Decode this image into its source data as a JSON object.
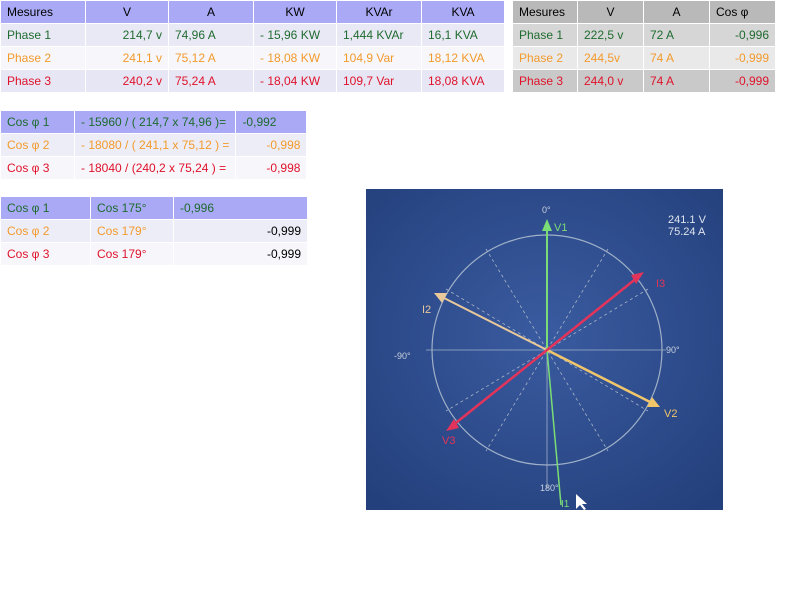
{
  "table1": {
    "headers": [
      "Mesures",
      "V",
      "A",
      "KW",
      "KVAr",
      "KVA"
    ],
    "rows": [
      {
        "phase": "Phase 1",
        "v": "214,7 v",
        "a": "74,96 A",
        "kw": "- 15,96 KW",
        "kvar": "1,444 KVAr",
        "kva": "16,1 KVA"
      },
      {
        "phase": "Phase 2",
        "v": "241,1 v",
        "a": "75,12 A",
        "kw": "- 18,08 KW",
        "kvar": "104,9 Var",
        "kva": "18,12 KVA"
      },
      {
        "phase": "Phase 3",
        "v": "240,2 v",
        "a": "75,24 A",
        "kw": "- 18,04 KW",
        "kvar": "109,7 Var",
        "kva": "18,08  KVA"
      }
    ]
  },
  "table2": {
    "headers": [
      "Mesures",
      "V",
      "A",
      "Cos φ"
    ],
    "rows": [
      {
        "phase": "Phase 1",
        "v": "222,5 v",
        "a": "72 A",
        "cos": "-0,996"
      },
      {
        "phase": "Phase 2",
        "v": "244,5v",
        "a": "74 A",
        "cos": "-0,999"
      },
      {
        "phase": "Phase 3",
        "v": "244,0 v",
        "a": "74 A",
        "cos": "-0,999"
      }
    ]
  },
  "cos_calc": [
    {
      "label": "Cos φ 1",
      "formula": "- 15960 / ( 214,7 x 74,96 )=",
      "value": "-0,992"
    },
    {
      "label": "Cos φ 2",
      "formula": "- 18080 / ( 241,1 x 75,12 ) =",
      "value": "-0,998"
    },
    {
      "label": "Cos φ 3",
      "formula": "- 18040 / (240,2 x 75,24 ) =",
      "value": "-0,998"
    }
  ],
  "cos_angle": [
    {
      "label": "Cos φ 1",
      "angle": "Cos 175°",
      "value": "-0,996"
    },
    {
      "label": "Cos φ 2",
      "angle": "Cos 179°",
      "value": "-0,999"
    },
    {
      "label": "Cos φ 3",
      "angle": "Cos 179°",
      "value": "-0,999"
    }
  ],
  "photo": {
    "readout_v": "241.1 V",
    "readout_a": "75.24 A",
    "label_0": "0°",
    "label_90": "90°",
    "label_m90": "-90°",
    "label_180": "180°",
    "v1": "V1",
    "v2": "V2",
    "v3": "V3",
    "i2": "I2",
    "i3": "I3",
    "i1": "I1"
  },
  "colors": {
    "phase1": "#1f6b2f",
    "phase2": "#f39a2c",
    "phase3": "#e0122a",
    "header_blue": "#a9a9f5",
    "header_gray": "#b9b9b9",
    "photo_bg": "#2f4a8a"
  }
}
